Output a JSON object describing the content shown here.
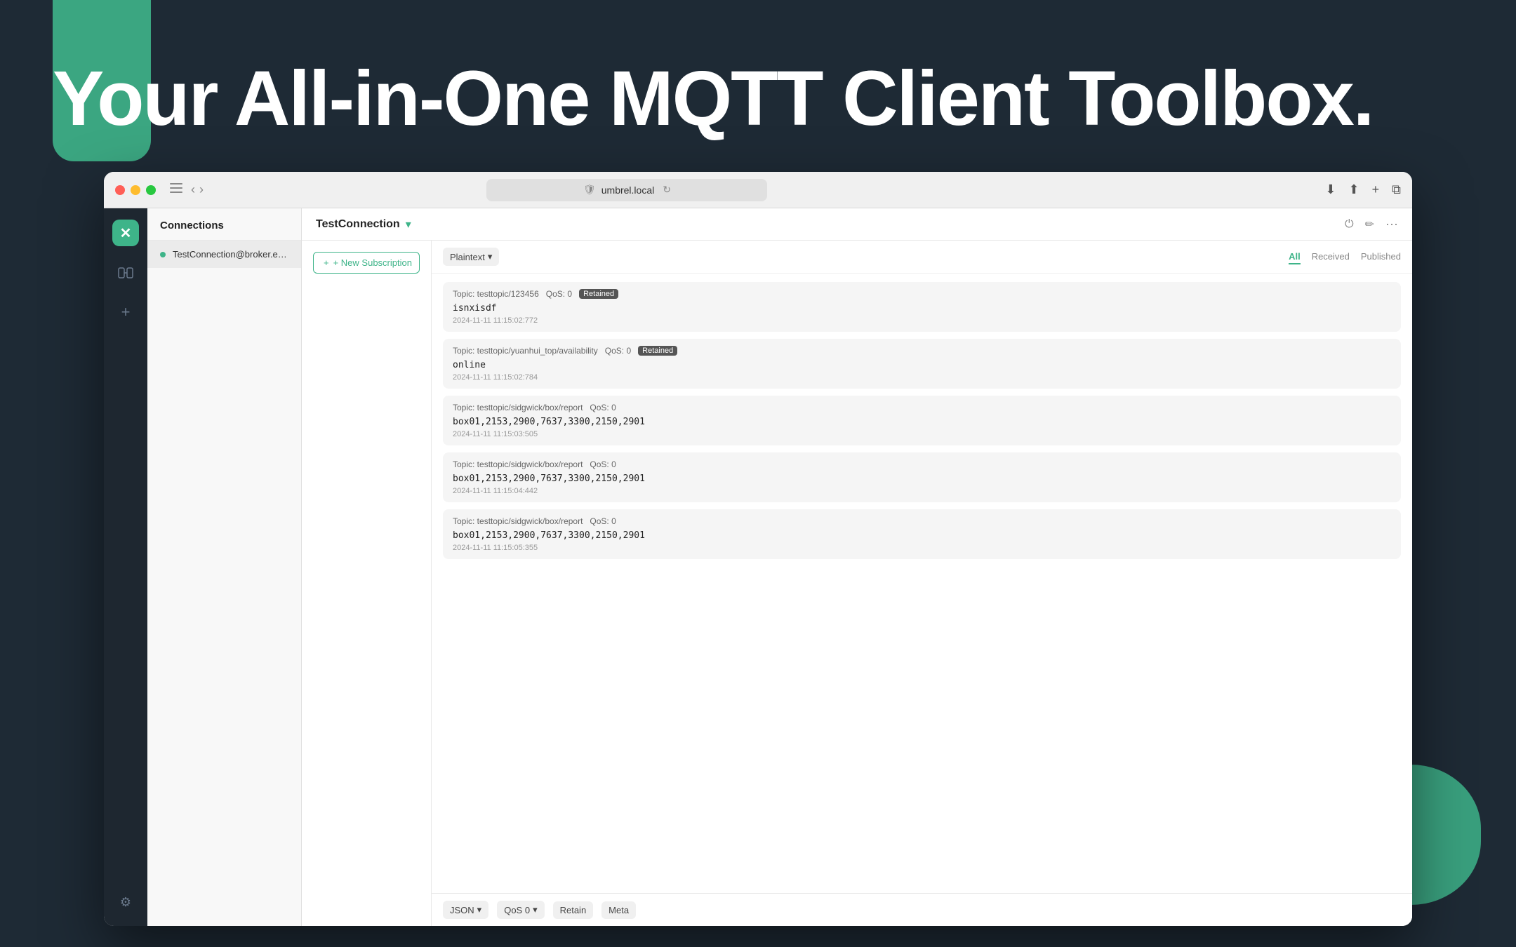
{
  "background": {
    "color": "#1e2a35"
  },
  "hero": {
    "text": "Your All-in-One MQTT Client Toolbox."
  },
  "browser": {
    "traffic_lights": [
      "red",
      "yellow",
      "green"
    ],
    "address_bar": {
      "url": "umbrel.local",
      "shield_icon": "shield"
    },
    "toolbar_icons": [
      "download-icon",
      "share-icon",
      "add-tab-icon",
      "tabs-icon"
    ]
  },
  "sidebar": {
    "main_icon": "✕",
    "items": [
      {
        "icon": "⊞",
        "name": "connections-icon"
      },
      {
        "icon": "+",
        "name": "add-icon"
      }
    ],
    "bottom_icon": {
      "icon": "⚙",
      "name": "settings-icon"
    }
  },
  "connections_panel": {
    "header": "Connections",
    "items": [
      {
        "name": "TestConnection@broker.em...",
        "status": "connected"
      }
    ]
  },
  "connection_bar": {
    "title": "TestConnection",
    "chevron": "▾",
    "actions": [
      "power-icon",
      "edit-icon",
      "more-icon"
    ]
  },
  "subscription_button": {
    "label": "+ New Subscription"
  },
  "filter_bar": {
    "format_label": "Plaintext",
    "format_chevron": "▾",
    "tabs": [
      {
        "label": "All",
        "active": true
      },
      {
        "label": "Received",
        "active": false
      },
      {
        "label": "Published",
        "active": false
      }
    ]
  },
  "messages": [
    {
      "topic": "Topic: testtopic/123456",
      "qos": "QoS: 0",
      "retained": true,
      "payload": "isnxisdf",
      "timestamp": "2024-11-11 11:15:02:772"
    },
    {
      "topic": "Topic: testtopic/yuanhui_top/availability",
      "qos": "QoS: 0",
      "retained": true,
      "payload": "online",
      "timestamp": "2024-11-11 11:15:02:784"
    },
    {
      "topic": "Topic: testtopic/sidgwick/box/report",
      "qos": "QoS: 0",
      "retained": false,
      "payload": "box01,2153,2900,7637,3300,2150,2901",
      "timestamp": "2024-11-11 11:15:03:505"
    },
    {
      "topic": "Topic: testtopic/sidgwick/box/report",
      "qos": "QoS: 0",
      "retained": false,
      "payload": "box01,2153,2900,7637,3300,2150,2901",
      "timestamp": "2024-11-11 11:15:04:442"
    },
    {
      "topic": "Topic: testtopic/sidgwick/box/report",
      "qos": "QoS: 0",
      "retained": false,
      "payload": "box01,2153,2900,7637,3300,2150,2901",
      "timestamp": "2024-11-11 11:15:05:355"
    }
  ],
  "bottom_bar": {
    "format_label": "JSON",
    "format_chevron": "▾",
    "qos_label": "QoS 0",
    "qos_chevron": "▾",
    "retain_label": "Retain",
    "meta_label": "Meta"
  }
}
